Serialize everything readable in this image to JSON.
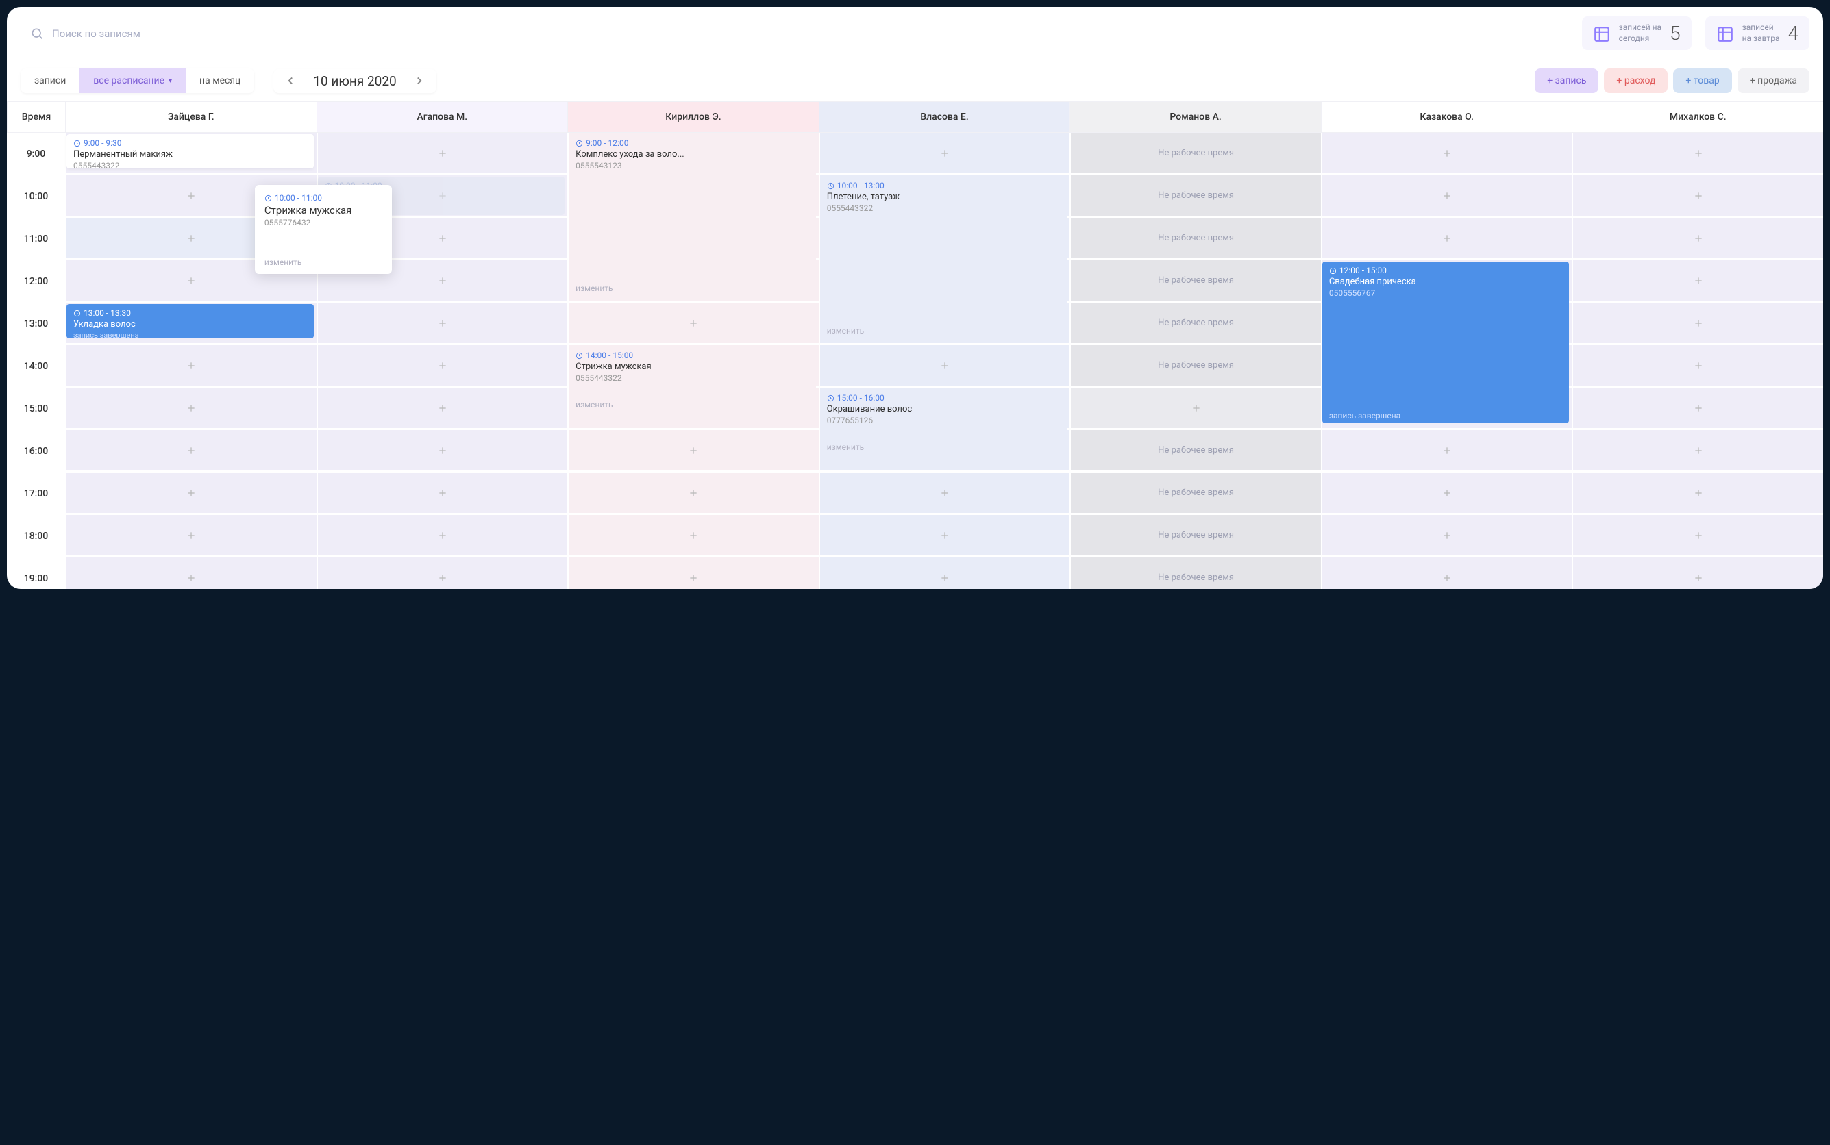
{
  "search": {
    "placeholder": "Поиск по записям"
  },
  "stats": {
    "today": {
      "line1": "записей на",
      "line2": "сегодня",
      "count": "5"
    },
    "tomorrow": {
      "line1": "записей",
      "line2": "на завтра",
      "count": "4"
    }
  },
  "tabs": {
    "records": "записи",
    "schedule": "все расписание",
    "month": "на месяц"
  },
  "date": "10 июня 2020",
  "actions": {
    "record": "+ запись",
    "expense": "+ расход",
    "goods": "+ товар",
    "sale": "+ продажа"
  },
  "headers": {
    "time": "Время",
    "staff": [
      "Зайцева Г.",
      "Агапова М.",
      "Кириллов Э.",
      "Власова Е.",
      "Романов А.",
      "Казакова О.",
      "Михалков С."
    ]
  },
  "times": [
    "9:00",
    "10:00",
    "11:00",
    "12:00",
    "13:00",
    "14:00",
    "15:00",
    "16:00",
    "17:00",
    "18:00",
    "19:00"
  ],
  "unavail_label": "Не рабочее время",
  "edit_label": "изменить",
  "status_done": "запись завершена",
  "appointments": {
    "a1": {
      "time": "9:00 - 9:30",
      "title": "Перманентный макияж",
      "phone": "0555443322"
    },
    "a2_ghost": {
      "time": "10:00 - 11:00"
    },
    "a2": {
      "time": "10:00 - 11:00",
      "title": "Стрижка мужская",
      "phone": "0555776432"
    },
    "a3": {
      "time": "9:00 - 12:00",
      "title": "Комплекс ухода за воло...",
      "phone": "0555543123"
    },
    "a4": {
      "time": "10:00 - 13:00",
      "title": "Плетение, татуаж",
      "phone": "0555443322"
    },
    "a5": {
      "time": "13:00 - 13:30",
      "title": "Укладка волос"
    },
    "a6": {
      "time": "14:00 - 15:00",
      "title": "Стрижка мужская",
      "phone": "0555443322"
    },
    "a7": {
      "time": "15:00 - 16:00",
      "title": "Окрашивание волос",
      "phone": "0777655126"
    },
    "a8": {
      "time": "12:00 - 15:00",
      "title": "Свадебная прическа",
      "phone": "0505556767"
    }
  }
}
